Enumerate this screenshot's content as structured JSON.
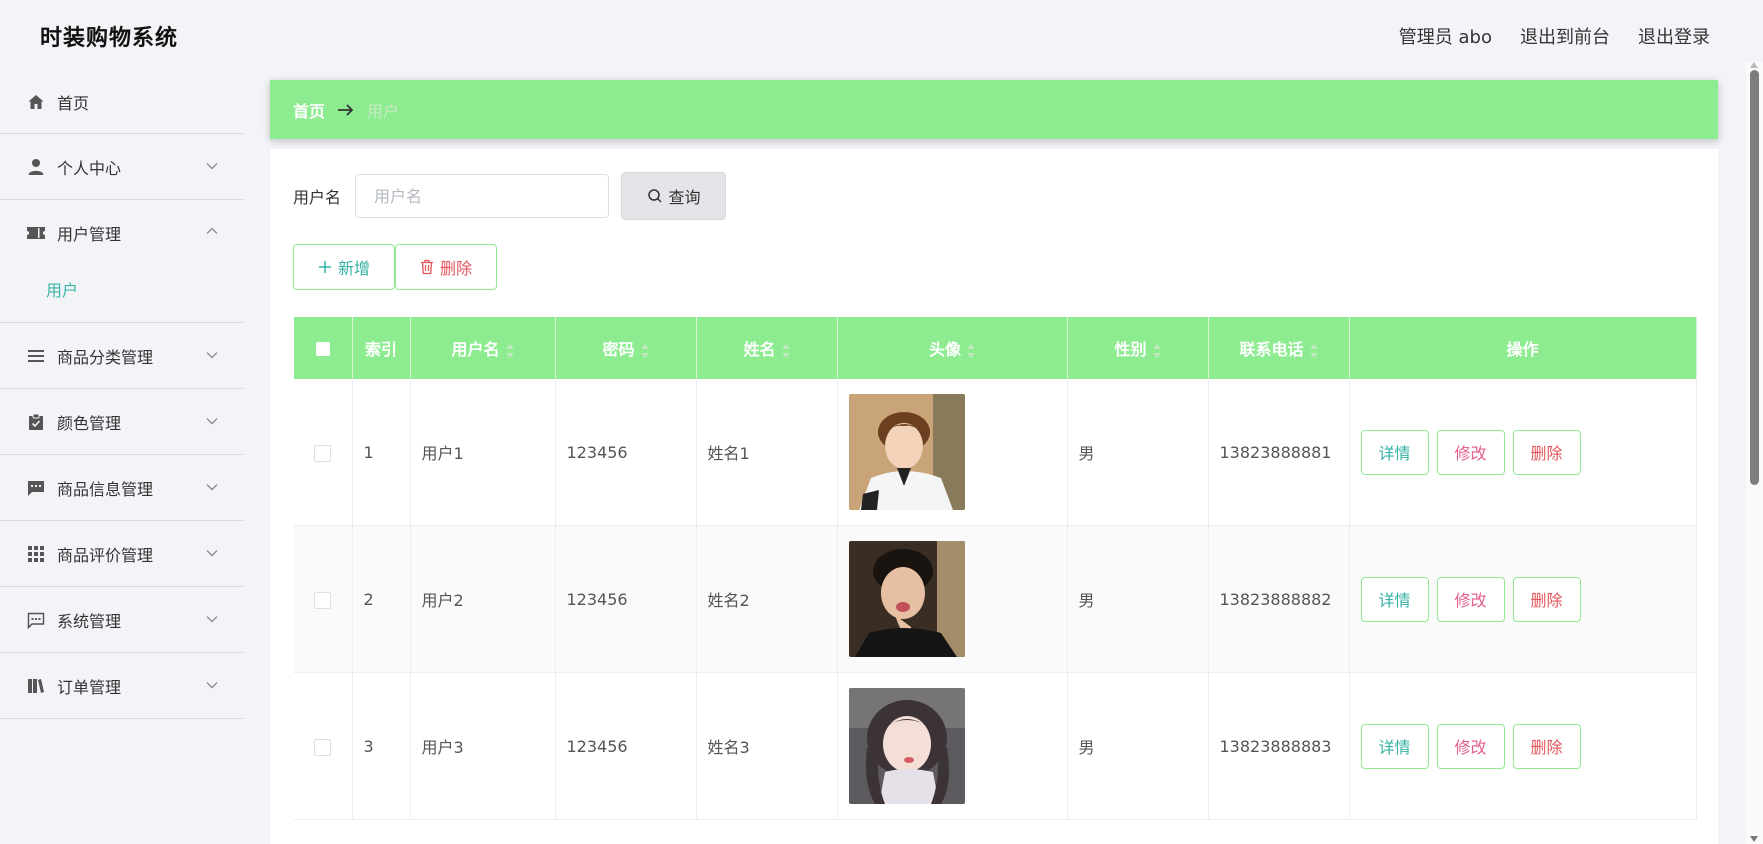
{
  "header": {
    "title": "时装购物系统",
    "admin": "管理员 abo",
    "back_to_front": "退出到前台",
    "logout": "退出登录"
  },
  "sidebar": {
    "items": [
      {
        "label": "首页",
        "icon": "home-icon"
      },
      {
        "label": "个人中心",
        "icon": "person-icon"
      },
      {
        "label": "用户管理",
        "icon": "ticket-icon",
        "expanded": true,
        "children": [
          {
            "label": "用户"
          }
        ]
      },
      {
        "label": "商品分类管理",
        "icon": "list-icon"
      },
      {
        "label": "颜色管理",
        "icon": "clipboard-icon"
      },
      {
        "label": "商品信息管理",
        "icon": "chat-icon"
      },
      {
        "label": "商品评价管理",
        "icon": "grid-icon"
      },
      {
        "label": "系统管理",
        "icon": "message-dots-icon"
      },
      {
        "label": "订单管理",
        "icon": "book-icon"
      }
    ]
  },
  "breadcrumb": {
    "home": "首页",
    "current": "用户"
  },
  "search": {
    "label": "用户名",
    "placeholder": "用户名",
    "value": "",
    "button": "查询"
  },
  "actions": {
    "add": "新增",
    "delete": "删除"
  },
  "table": {
    "headers": {
      "index": "索引",
      "username": "用户名",
      "password": "密码",
      "name": "姓名",
      "avatar": "头像",
      "gender": "性别",
      "phone": "联系电话",
      "ops": "操作"
    },
    "rows": [
      {
        "index": "1",
        "username": "用户1",
        "password": "123456",
        "name": "姓名1",
        "gender": "男",
        "phone": "13823888881"
      },
      {
        "index": "2",
        "username": "用户2",
        "password": "123456",
        "name": "姓名2",
        "gender": "男",
        "phone": "13823888882"
      },
      {
        "index": "3",
        "username": "用户3",
        "password": "123456",
        "name": "姓名3",
        "gender": "男",
        "phone": "13823888883"
      }
    ],
    "op_labels": {
      "detail": "详情",
      "edit": "修改",
      "delete": "删除"
    }
  },
  "colors": {
    "accent": "#8eec90",
    "teal": "#35b0a5",
    "pink": "#e45d8f",
    "red": "#e4555c"
  }
}
